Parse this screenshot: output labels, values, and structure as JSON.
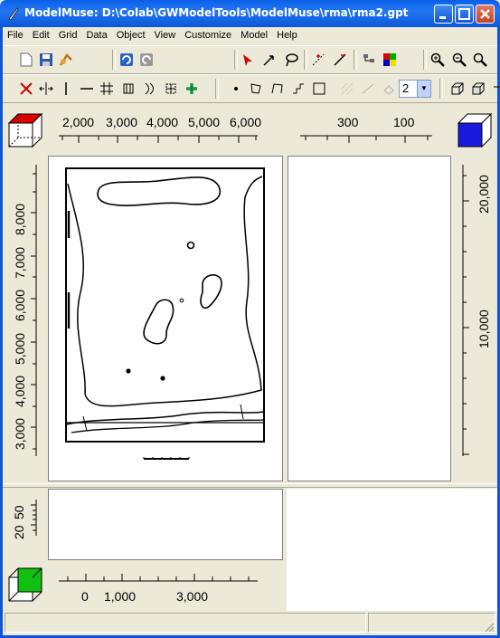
{
  "window": {
    "title": "ModelMuse: D:\\Colab\\GWModelTools\\ModelMuse\\rma\\rma2.gpt"
  },
  "menu": [
    "File",
    "Edit",
    "Grid",
    "Data",
    "Object",
    "View",
    "Customize",
    "Model",
    "Help"
  ],
  "toolbar": {
    "layer_value": "2"
  },
  "top_ruler": {
    "ticks": [
      "2,000",
      "3,000",
      "4,000",
      "5,000",
      "6,000"
    ]
  },
  "side_top_ruler": {
    "ticks": [
      "300",
      "100"
    ]
  },
  "left_ruler": {
    "ticks": [
      "8,000",
      "7,000",
      "6,000",
      "5,000",
      "4,000",
      "3,000"
    ]
  },
  "right_ruler": {
    "ticks": [
      "20,000",
      "10,000"
    ]
  },
  "front_left_ruler": {
    "ticks": [
      "20",
      "50"
    ]
  },
  "bottom_ruler": {
    "ticks": [
      "0",
      "1,000",
      "3,000"
    ]
  }
}
